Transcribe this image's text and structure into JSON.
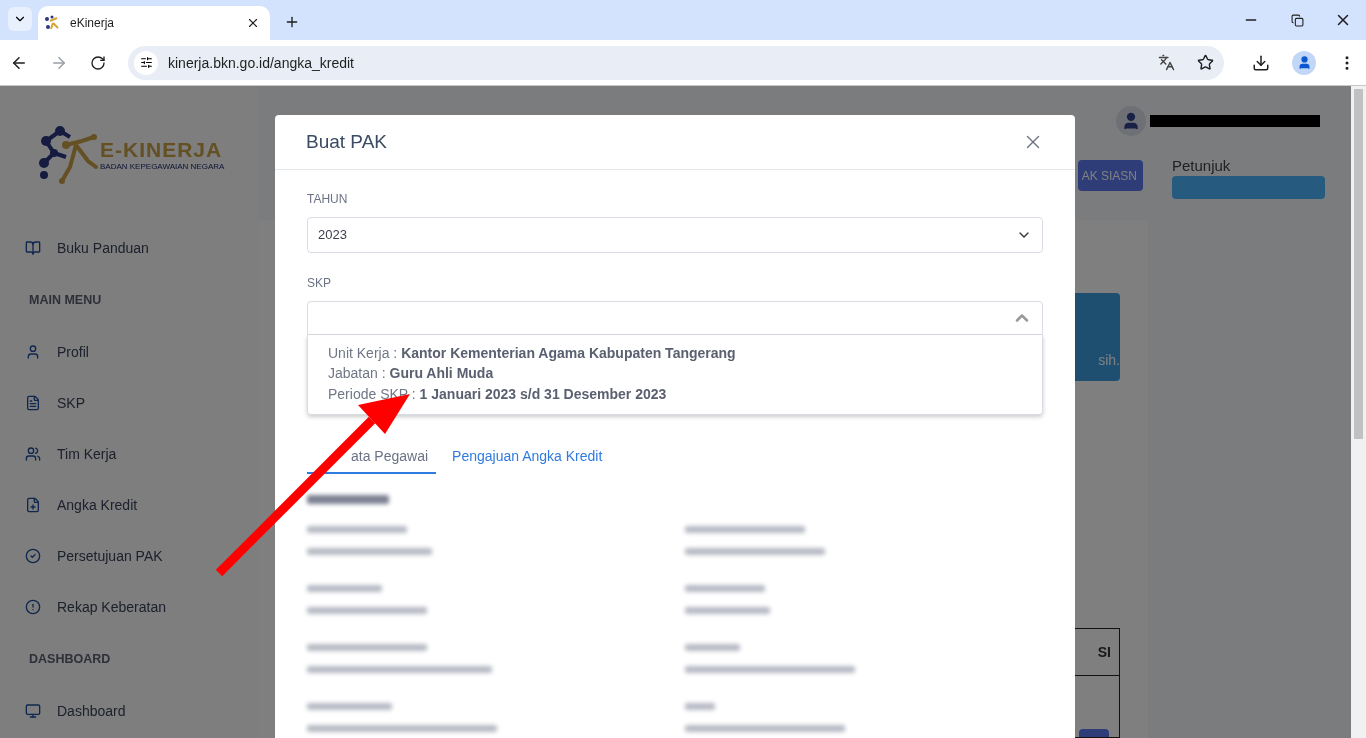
{
  "browser": {
    "tab_title": "eKinerja",
    "url": "kinerja.bkn.go.id/angka_kredit"
  },
  "sidebar": {
    "logo": {
      "title": "E-KINERJA",
      "subtitle": "BADAN KEPEGAWAIAN NEGARA"
    },
    "items": [
      {
        "kind": "link",
        "label": "Buku Panduan"
      },
      {
        "kind": "heading",
        "label": "MAIN MENU"
      },
      {
        "kind": "link",
        "label": "Profil"
      },
      {
        "kind": "link",
        "label": "SKP"
      },
      {
        "kind": "link",
        "label": "Tim Kerja"
      },
      {
        "kind": "link",
        "label": "Angka Kredit"
      },
      {
        "kind": "link",
        "label": "Persetujuan PAK"
      },
      {
        "kind": "link",
        "label": "Rekap Keberatan"
      },
      {
        "kind": "heading",
        "label": "DASHBOARD"
      },
      {
        "kind": "link",
        "label": "Dashboard"
      }
    ]
  },
  "background": {
    "sync_button": "AK SIASN",
    "guide_label": "Petunjuk",
    "alert_text": "sih.",
    "table_header": "SI"
  },
  "modal": {
    "title": "Buat PAK",
    "fields": [
      {
        "label": "TAHUN",
        "value": "2023",
        "expanded": false
      },
      {
        "label": "SKP",
        "expanded": true,
        "options": [
          {
            "lines": [
              "Unit Kerja : **Kantor Kementerian Agama Kabupaten Tangerang**",
              "Jabatan : **Guru Ahli Muda**",
              "Periode SKP : **1 Januari 2023 s/d 31 Desember 2023**"
            ]
          }
        ]
      }
    ],
    "tabs": [
      {
        "label": "ata Pegawai",
        "selected": true
      },
      {
        "label": "Pengajuan Angka Kredit",
        "selected": false
      }
    ]
  }
}
